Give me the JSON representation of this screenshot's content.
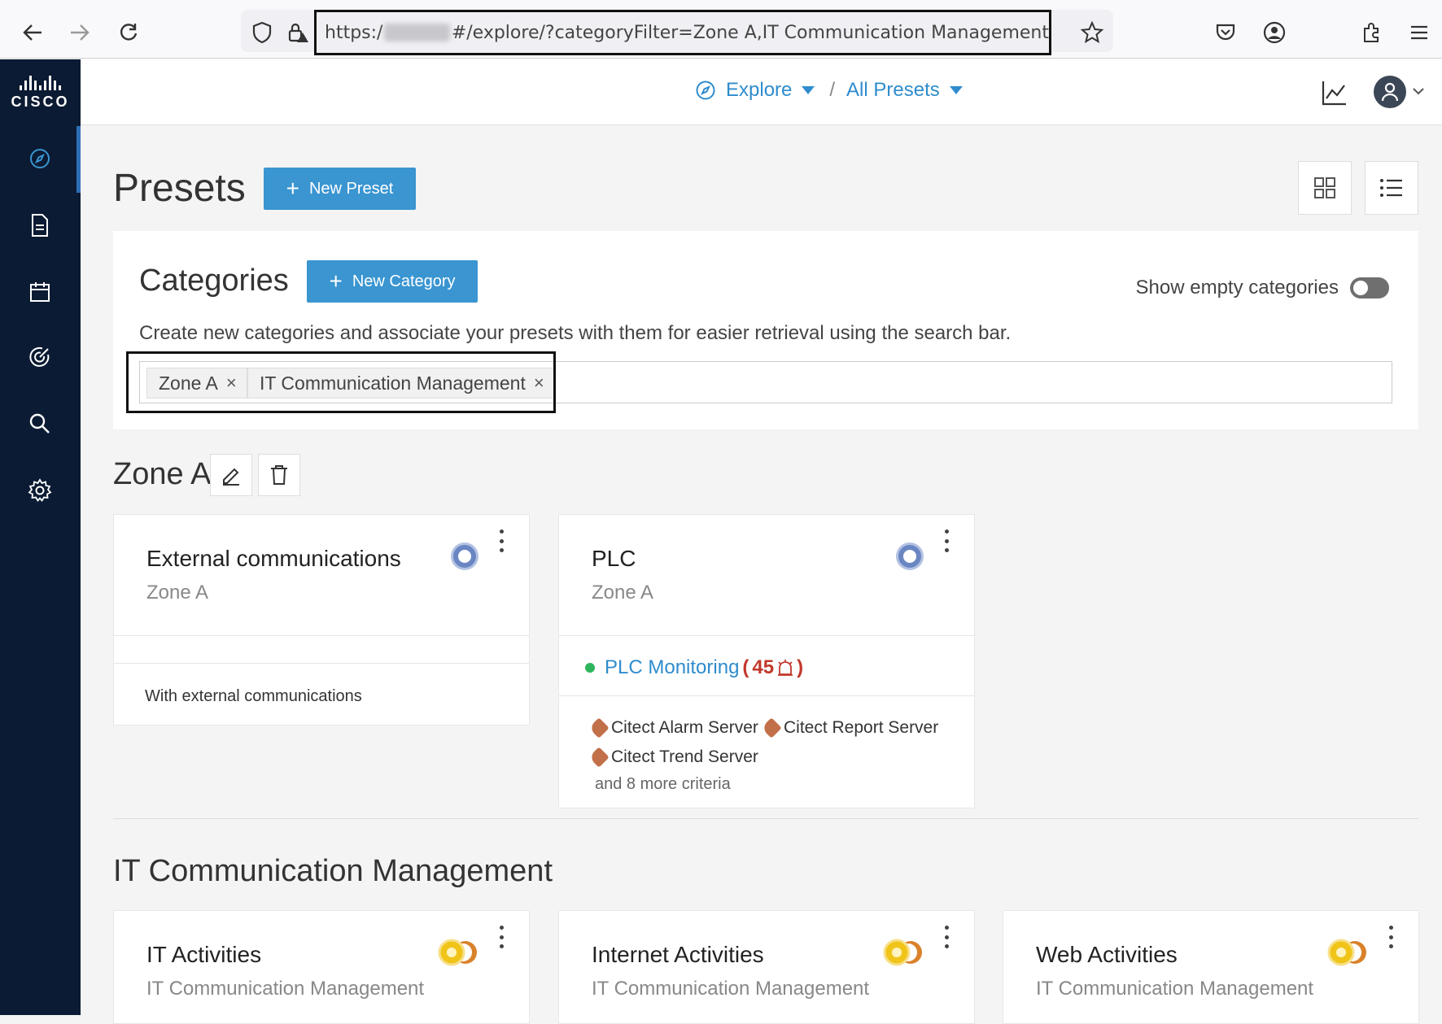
{
  "browser": {
    "url_prefix": "https:/",
    "url_suffix": "#/explore/?categoryFilter=Zone A,IT Communication Management"
  },
  "appbar": {
    "breadcrumb": [
      {
        "label": "Explore"
      },
      {
        "label": "All Presets"
      }
    ],
    "separator": "/"
  },
  "page": {
    "title": "Presets",
    "new_preset_label": "New Preset"
  },
  "categories": {
    "title": "Categories",
    "new_category_label": "New Category",
    "show_empty_label": "Show empty categories",
    "show_empty_on": false,
    "description": "Create new categories and associate your presets with them for easier retrieval using the search bar.",
    "filters": [
      "Zone A",
      "IT Communication Management"
    ]
  },
  "sections": [
    {
      "title": "Zone A",
      "cards": [
        {
          "title": "External communications",
          "subtitle": "Zone A",
          "description": "With external communications"
        },
        {
          "title": "PLC",
          "subtitle": "Zone A",
          "monitoring_label": "PLC Monitoring",
          "monitoring_count": "45",
          "criteria": [
            "Citect Alarm Server",
            "Citect Report Server",
            "Citect Trend Server"
          ],
          "more_criteria": "and 8 more criteria"
        }
      ]
    },
    {
      "title": "IT Communication Management",
      "cards": [
        {
          "title": "IT Activities",
          "subtitle": "IT Communication Management"
        },
        {
          "title": "Internet Activities",
          "subtitle": "IT Communication Management"
        },
        {
          "title": "Web Activities",
          "subtitle": "IT Communication Management"
        }
      ]
    }
  ],
  "colors": {
    "accent": "#3a95d1",
    "sidebar": "#0b1b33",
    "link": "#2f8ccd",
    "alert": "#c0392b",
    "status_ok": "#2fb55e"
  },
  "logo_text": "CISCO"
}
